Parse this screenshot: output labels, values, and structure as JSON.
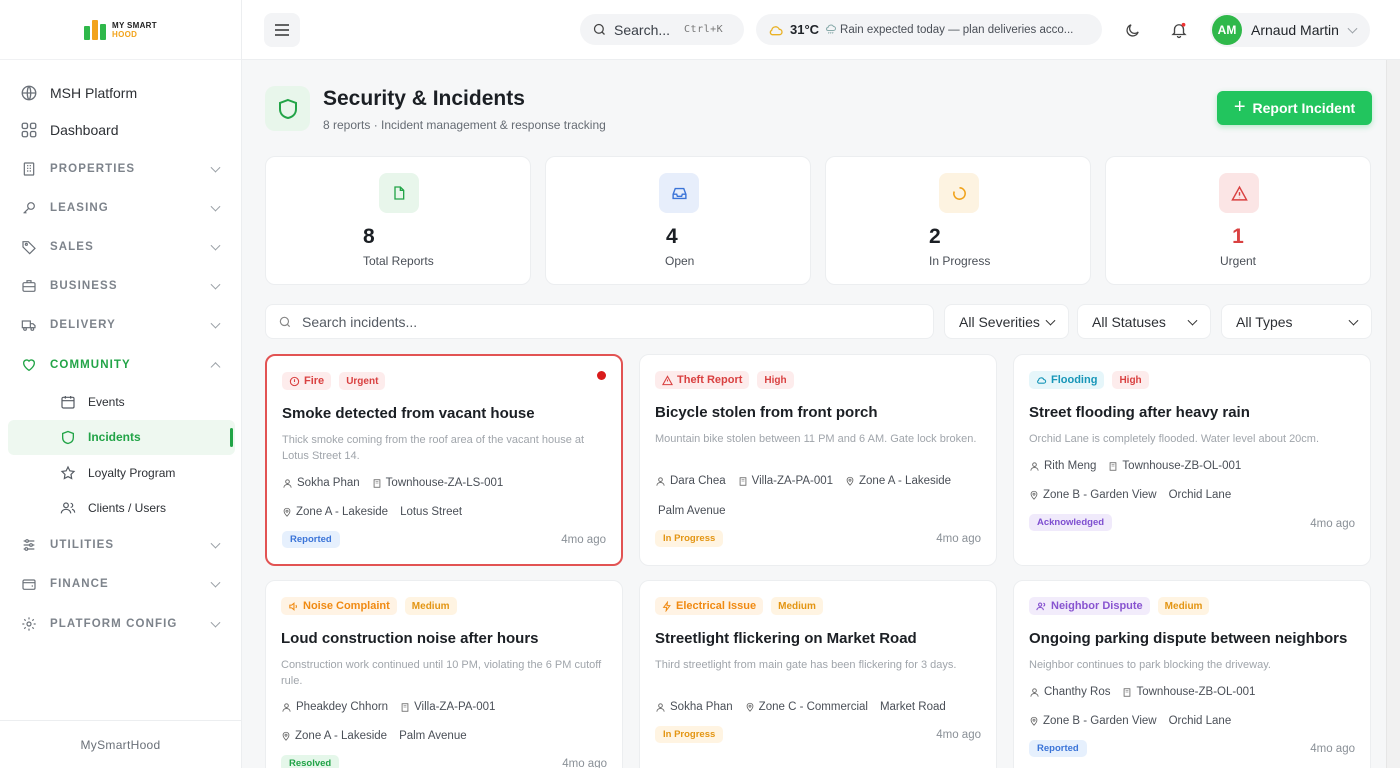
{
  "brand": {
    "line1": "MY SMART",
    "line2": "HOOD",
    "footer": "MySmartHood"
  },
  "sidebar": {
    "top_items": [
      {
        "label": "MSH Platform",
        "icon": "globe-icon"
      },
      {
        "label": "Dashboard",
        "icon": "grid-icon"
      }
    ],
    "sections": [
      {
        "label": "PROPERTIES",
        "icon": "building-icon",
        "expanded": false
      },
      {
        "label": "LEASING",
        "icon": "key-icon",
        "expanded": false
      },
      {
        "label": "SALES",
        "icon": "tag-icon",
        "expanded": false
      },
      {
        "label": "BUSINESS",
        "icon": "briefcase-icon",
        "expanded": false
      },
      {
        "label": "DELIVERY",
        "icon": "truck-icon",
        "expanded": false
      },
      {
        "label": "COMMUNITY",
        "icon": "heart-icon",
        "expanded": true
      }
    ],
    "community_items": [
      {
        "label": "Events",
        "icon": "calendar-icon"
      },
      {
        "label": "Incidents",
        "icon": "shield-icon",
        "active": true
      },
      {
        "label": "Loyalty Program",
        "icon": "star-icon"
      },
      {
        "label": "Clients / Users",
        "icon": "users-icon"
      }
    ],
    "bottom_sections": [
      {
        "label": "UTILITIES",
        "icon": "sliders-icon"
      },
      {
        "label": "FINANCE",
        "icon": "wallet-icon"
      },
      {
        "label": "PLATFORM CONFIG",
        "icon": "gear-icon"
      }
    ]
  },
  "topbar": {
    "search_label": "Search...",
    "search_shortcut": "Ctrl+K",
    "weather_temp": "31°C",
    "weather_text": "Rain expected today — plan deliveries acco...",
    "user_initials": "AM",
    "user_name": "Arnaud Martin"
  },
  "page": {
    "title": "Security & Incidents",
    "subtitle": "8 reports · Incident management & response tracking",
    "report_button": "Report Incident"
  },
  "stats": [
    {
      "value": "8",
      "label": "Total Reports",
      "icon": "file-icon",
      "color": "#22a447",
      "bg": "#e8f6eb"
    },
    {
      "value": "4",
      "label": "Open",
      "icon": "inbox-icon",
      "color": "#3b74d8",
      "bg": "#e7eefb"
    },
    {
      "value": "2",
      "label": "In Progress",
      "icon": "spinner-icon",
      "color": "#f0a21b",
      "bg": "#fdf3e1"
    },
    {
      "value": "1",
      "label": "Urgent",
      "icon": "warning-icon",
      "color": "#d94141",
      "bg": "#fbe5e5"
    }
  ],
  "filters": {
    "search_placeholder": "Search incidents...",
    "severity": "All Severities",
    "status": "All Statuses",
    "type": "All Types"
  },
  "incidents": [
    {
      "type": "Fire",
      "type_icon": "alert-circle-icon",
      "type_style": "type-red",
      "severity": "Urgent",
      "sev_style": "sev-red",
      "title": "Smoke detected from vacant house",
      "desc": "Thick smoke coming from the roof area of the vacant house at Lotus Street 14.",
      "reporter": "Sokha Phan",
      "unit": "Townhouse-ZA-LS-001",
      "zone": "Zone A - Lakeside",
      "street": "Lotus Street",
      "status": "Reported",
      "status_style": "reported",
      "ago": "4mo ago",
      "urgent": true
    },
    {
      "type": "Theft Report",
      "type_icon": "warning-icon",
      "type_style": "type-red",
      "severity": "High",
      "sev_style": "sev-red",
      "title": "Bicycle stolen from front porch",
      "desc": "Mountain bike stolen between 11 PM and 6 AM. Gate lock broken.",
      "reporter": "Dara Chea",
      "unit": "Villa-ZA-PA-001",
      "zone": "Zone A - Lakeside",
      "street": "Palm Avenue",
      "status": "In Progress",
      "status_style": "inprog",
      "ago": "4mo ago",
      "urgent": false
    },
    {
      "type": "Flooding",
      "type_icon": "cloud-icon",
      "type_style": "type-cyan",
      "severity": "High",
      "sev_style": "sev-red",
      "title": "Street flooding after heavy rain",
      "desc": "Orchid Lane is completely flooded. Water level about 20cm.",
      "reporter": "Rith Meng",
      "unit": "Townhouse-ZB-OL-001",
      "zone": "Zone B - Garden View",
      "street": "Orchid Lane",
      "status": "Acknowledged",
      "status_style": "ack",
      "ago": "4mo ago",
      "urgent": false
    },
    {
      "type": "Noise Complaint",
      "type_icon": "speaker-icon",
      "type_style": "type-orange",
      "severity": "Medium",
      "sev_style": "sev-orange",
      "title": "Loud construction noise after hours",
      "desc": "Construction work continued until 10 PM, violating the 6 PM cutoff rule.",
      "reporter": "Pheakdey Chhorn",
      "unit": "Villa-ZA-PA-001",
      "zone": "Zone A - Lakeside",
      "street": "Palm Avenue",
      "status": "Resolved",
      "status_style": "resolved",
      "ago": "4mo ago",
      "urgent": false
    },
    {
      "type": "Electrical Issue",
      "type_icon": "bolt-icon",
      "type_style": "type-orange",
      "severity": "Medium",
      "sev_style": "sev-orange",
      "title": "Streetlight flickering on Market Road",
      "desc": "Third streetlight from main gate has been flickering for 3 days.",
      "reporter": "Sokha Phan",
      "unit": "",
      "zone": "Zone C - Commercial",
      "street": "Market Road",
      "status": "In Progress",
      "status_style": "inprog",
      "ago": "4mo ago",
      "urgent": false
    },
    {
      "type": "Neighbor Dispute",
      "type_icon": "users-icon",
      "type_style": "type-purple",
      "severity": "Medium",
      "sev_style": "sev-orange",
      "title": "Ongoing parking dispute between neighbors",
      "desc": "Neighbor continues to park blocking the driveway.",
      "reporter": "Chanthy Ros",
      "unit": "Townhouse-ZB-OL-001",
      "zone": "Zone B - Garden View",
      "street": "Orchid Lane",
      "status": "Reported",
      "status_style": "reported",
      "ago": "4mo ago",
      "urgent": false
    }
  ]
}
